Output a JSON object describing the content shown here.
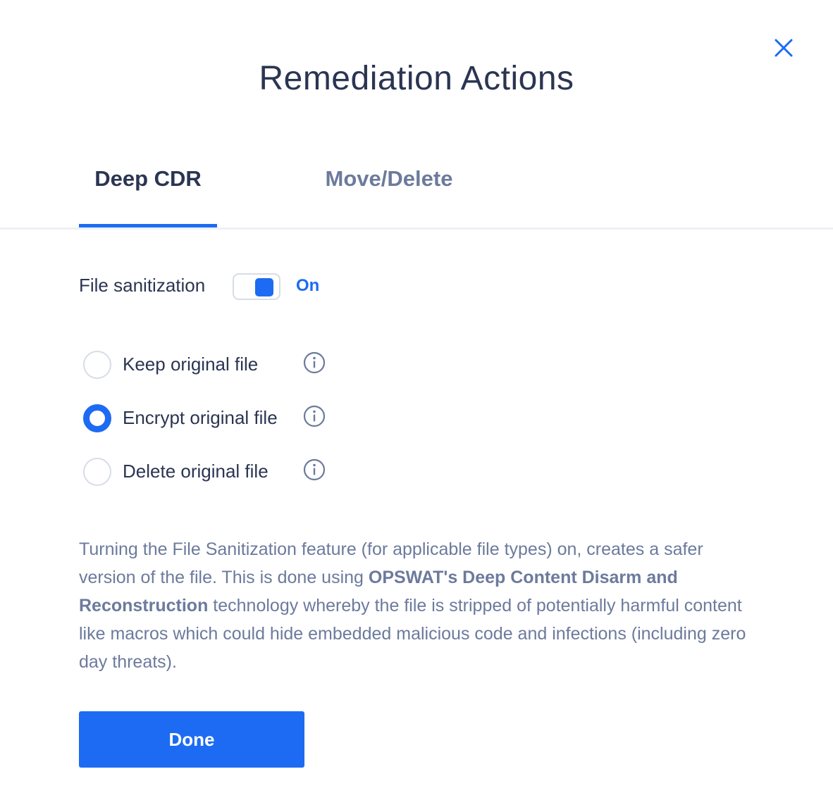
{
  "dialog": {
    "title": "Remediation Actions",
    "close_icon": "close-icon"
  },
  "tabs": [
    {
      "label": "Deep CDR",
      "active": true
    },
    {
      "label": "Move/Delete",
      "active": false
    }
  ],
  "sanitization": {
    "label": "File sanitization",
    "toggle_on": true,
    "state_label": "On"
  },
  "options": [
    {
      "label": "Keep original file",
      "selected": false,
      "icon": "info-icon"
    },
    {
      "label": "Encrypt original file",
      "selected": true,
      "icon": "info-icon"
    },
    {
      "label": "Delete original file",
      "selected": false,
      "icon": "info-icon"
    }
  ],
  "description": {
    "part1": "Turning the File Sanitization feature (for applicable file types) on, creates a safer version of the file. This is done using ",
    "bold": "OPSWAT's Deep Content Disarm and Reconstruction",
    "part2": " technology whereby the file is stripped of potentially harmful content like macros which could hide embedded malicious code and infections (including zero day threats)."
  },
  "done_label": "Done",
  "colors": {
    "accent": "#1d6bf3",
    "text_dark": "#2b3552",
    "text_muted": "#6c7a9c",
    "border": "#d8dce6"
  }
}
